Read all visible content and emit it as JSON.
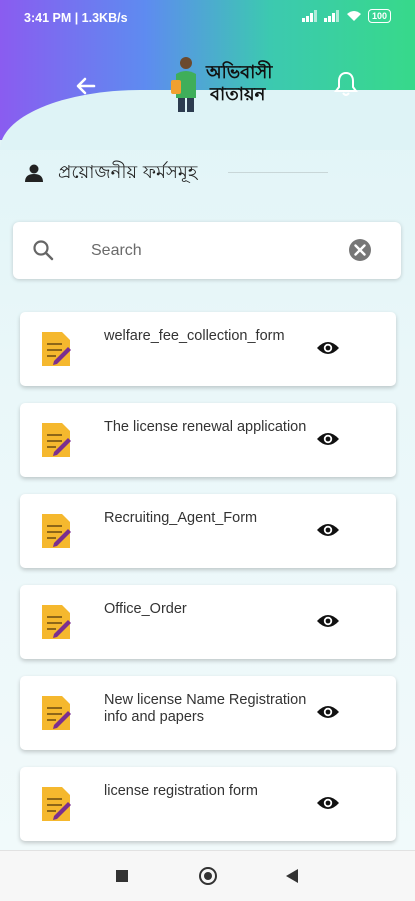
{
  "status_bar": {
    "time": "3:41 PM | 1.3KB/s",
    "battery": "100"
  },
  "header": {
    "logo_line1": "অভিবাসী",
    "logo_line2": "বাতায়ন"
  },
  "section": {
    "title": "প্রয়োজনীয় ফর্মসমূহ"
  },
  "search": {
    "placeholder": "Search"
  },
  "forms": [
    {
      "label": "welfare_fee_collection_form"
    },
    {
      "label": "The license renewal application"
    },
    {
      "label": "Recruiting_Agent_Form"
    },
    {
      "label": "Office_Order"
    },
    {
      "label": "New license Name Registration info and papers"
    },
    {
      "label": "license registration form"
    }
  ],
  "colors": {
    "header_start": "#8a5cf0",
    "header_end": "#37d98a",
    "doc_icon": "#f5b82e",
    "doc_pen": "#7b2f8f"
  }
}
